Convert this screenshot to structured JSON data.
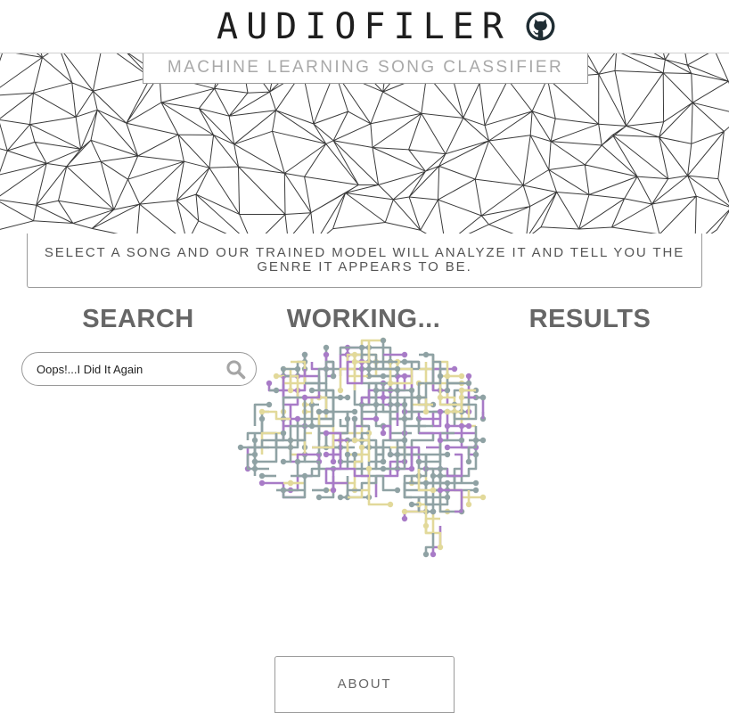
{
  "header": {
    "title": "AUDIOFILER",
    "github_icon": "github-icon"
  },
  "hero": {
    "subtitle": "MACHINE LEARNING SONG CLASSIFIER",
    "background": "triangle-mesh-pattern"
  },
  "description": "SELECT A SONG AND OUR TRAINED MODEL WILL ANALYZE IT AND TELL YOU THE GENRE IT APPEARS TO BE.",
  "steps": {
    "search": "SEARCH",
    "working": "WORKING...",
    "results": "RESULTS"
  },
  "search": {
    "value": "Oops!...I Did It Again",
    "icon": "search-icon"
  },
  "brain": {
    "icon": "circuit-brain-icon",
    "colors": [
      "#8fa2a4",
      "#a87bc7",
      "#e2d99a"
    ]
  },
  "about": {
    "label": "ABOUT"
  },
  "colors": {
    "text": "#555555",
    "heading": "#666666",
    "border": "#9a9a9a"
  }
}
